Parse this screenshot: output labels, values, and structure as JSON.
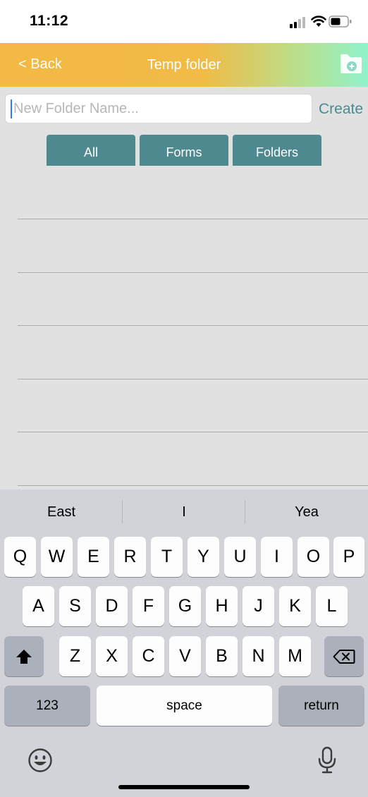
{
  "status_bar": {
    "time": "11:12"
  },
  "nav": {
    "back_label": "< Back",
    "title": "Temp folder",
    "add_icon": "folder-plus-icon"
  },
  "new_folder": {
    "placeholder": "New Folder Name...",
    "value": "",
    "create_label": "Create"
  },
  "segments": [
    {
      "label": "All"
    },
    {
      "label": "Forms"
    },
    {
      "label": "Folders"
    }
  ],
  "keyboard": {
    "suggestions": [
      "East",
      "I",
      "Yea"
    ],
    "row1": [
      "Q",
      "W",
      "E",
      "R",
      "T",
      "Y",
      "U",
      "I",
      "O",
      "P"
    ],
    "row2": [
      "A",
      "S",
      "D",
      "F",
      "G",
      "H",
      "J",
      "K",
      "L"
    ],
    "row3": [
      "Z",
      "X",
      "C",
      "V",
      "B",
      "N",
      "M"
    ],
    "numbers_label": "123",
    "space_label": "space",
    "return_label": "return"
  },
  "colors": {
    "accent": "#4a8b93",
    "segment": "#4e8990",
    "nav_start": "#f2b944",
    "nav_end": "#8ff3cc"
  }
}
